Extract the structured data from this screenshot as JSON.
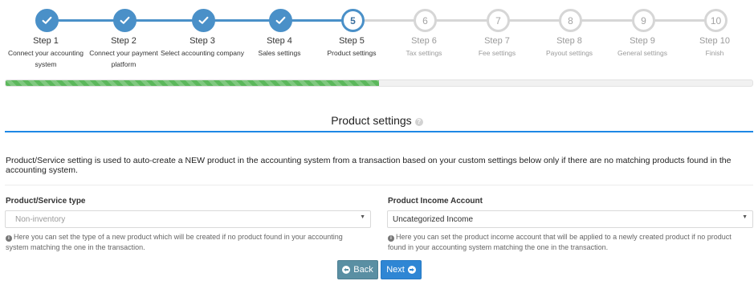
{
  "stepper": {
    "steps": [
      {
        "number": "1",
        "title": "Step 1",
        "desc": "Connect your accounting system",
        "state": "done"
      },
      {
        "number": "2",
        "title": "Step 2",
        "desc": "Connect your payment platform",
        "state": "done"
      },
      {
        "number": "3",
        "title": "Step 3",
        "desc": "Select accounting company",
        "state": "done"
      },
      {
        "number": "4",
        "title": "Step 4",
        "desc": "Sales settings",
        "state": "done"
      },
      {
        "number": "5",
        "title": "Step 5",
        "desc": "Product settings",
        "state": "current"
      },
      {
        "number": "6",
        "title": "Step 6",
        "desc": "Tax settings",
        "state": "todo"
      },
      {
        "number": "7",
        "title": "Step 7",
        "desc": "Fee settings",
        "state": "todo"
      },
      {
        "number": "8",
        "title": "Step 8",
        "desc": "Payout settings",
        "state": "todo"
      },
      {
        "number": "9",
        "title": "Step 9",
        "desc": "General settings",
        "state": "todo"
      },
      {
        "number": "10",
        "title": "Step 10",
        "desc": "Finish",
        "state": "todo"
      }
    ],
    "done_icon": "check-icon"
  },
  "progress": {
    "fraction": 0.5
  },
  "section": {
    "title": "Product settings",
    "help_icon": "question-circle-icon",
    "intro": "Product/Service setting is used to auto-create a NEW product in the accounting system from a transaction based on your custom settings below only if there are no matching products found in the accounting system."
  },
  "form": {
    "product_type": {
      "label": "Product/Service type",
      "value": "Non-inventory",
      "hint": "Here you can set the type of a new product which will be created if no product found in your accounting system matching the one in the transaction."
    },
    "income_account": {
      "label": "Product Income Account",
      "value": "Uncategorized Income",
      "hint": "Here you can set the product income account that will be applied to a newly created product if no product found in your accounting system matching the one in the transaction."
    }
  },
  "buttons": {
    "back": "Back",
    "next": "Next"
  },
  "colors": {
    "accent": "#4a90c8",
    "progress": "#5cb85c",
    "rule": "#1e88e5",
    "back_button": "#5a8fa3",
    "next_button": "#2f86d4"
  }
}
